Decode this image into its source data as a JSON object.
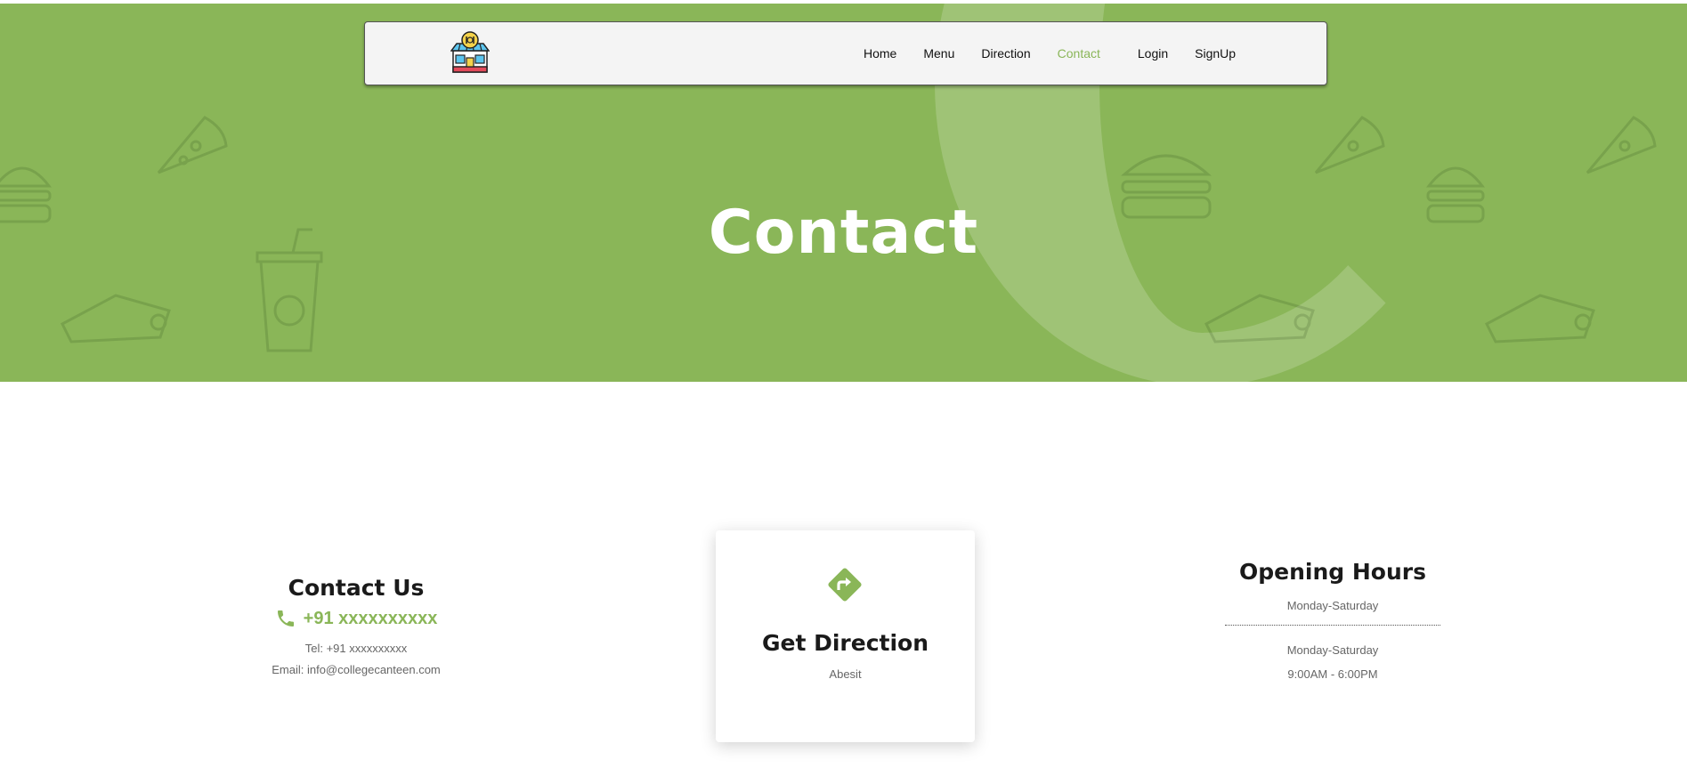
{
  "nav": {
    "items": [
      {
        "label": "Home",
        "active": false
      },
      {
        "label": "Menu",
        "active": false
      },
      {
        "label": "Direction",
        "active": false
      },
      {
        "label": "Contact",
        "active": true
      },
      {
        "label": "Login",
        "active": false
      },
      {
        "label": "SignUp",
        "active": false
      }
    ]
  },
  "hero": {
    "title": "Contact"
  },
  "contact": {
    "title": "Contact Us",
    "phone": "+91 xxxxxxxxxx",
    "tel": "Tel: +91 xxxxxxxxxx",
    "email": "Email: info@collegecanteen.com"
  },
  "direction": {
    "title": "Get Direction",
    "subtitle": "Abesit"
  },
  "hours": {
    "title": "Opening Hours",
    "line1": "Monday-Saturday",
    "line2": "Monday-Saturday",
    "line3": "9:00AM - 6:00PM"
  },
  "colors": {
    "accent": "#8ab658",
    "hero_bg": "#8ab658",
    "nav_bg": "#f4f4f4",
    "text_dark": "#1a1a1a",
    "text_muted": "#666666"
  },
  "icons": {
    "logo": "canteen-shop-icon",
    "phone": "phone-icon",
    "direction": "direction-sign-icon"
  }
}
